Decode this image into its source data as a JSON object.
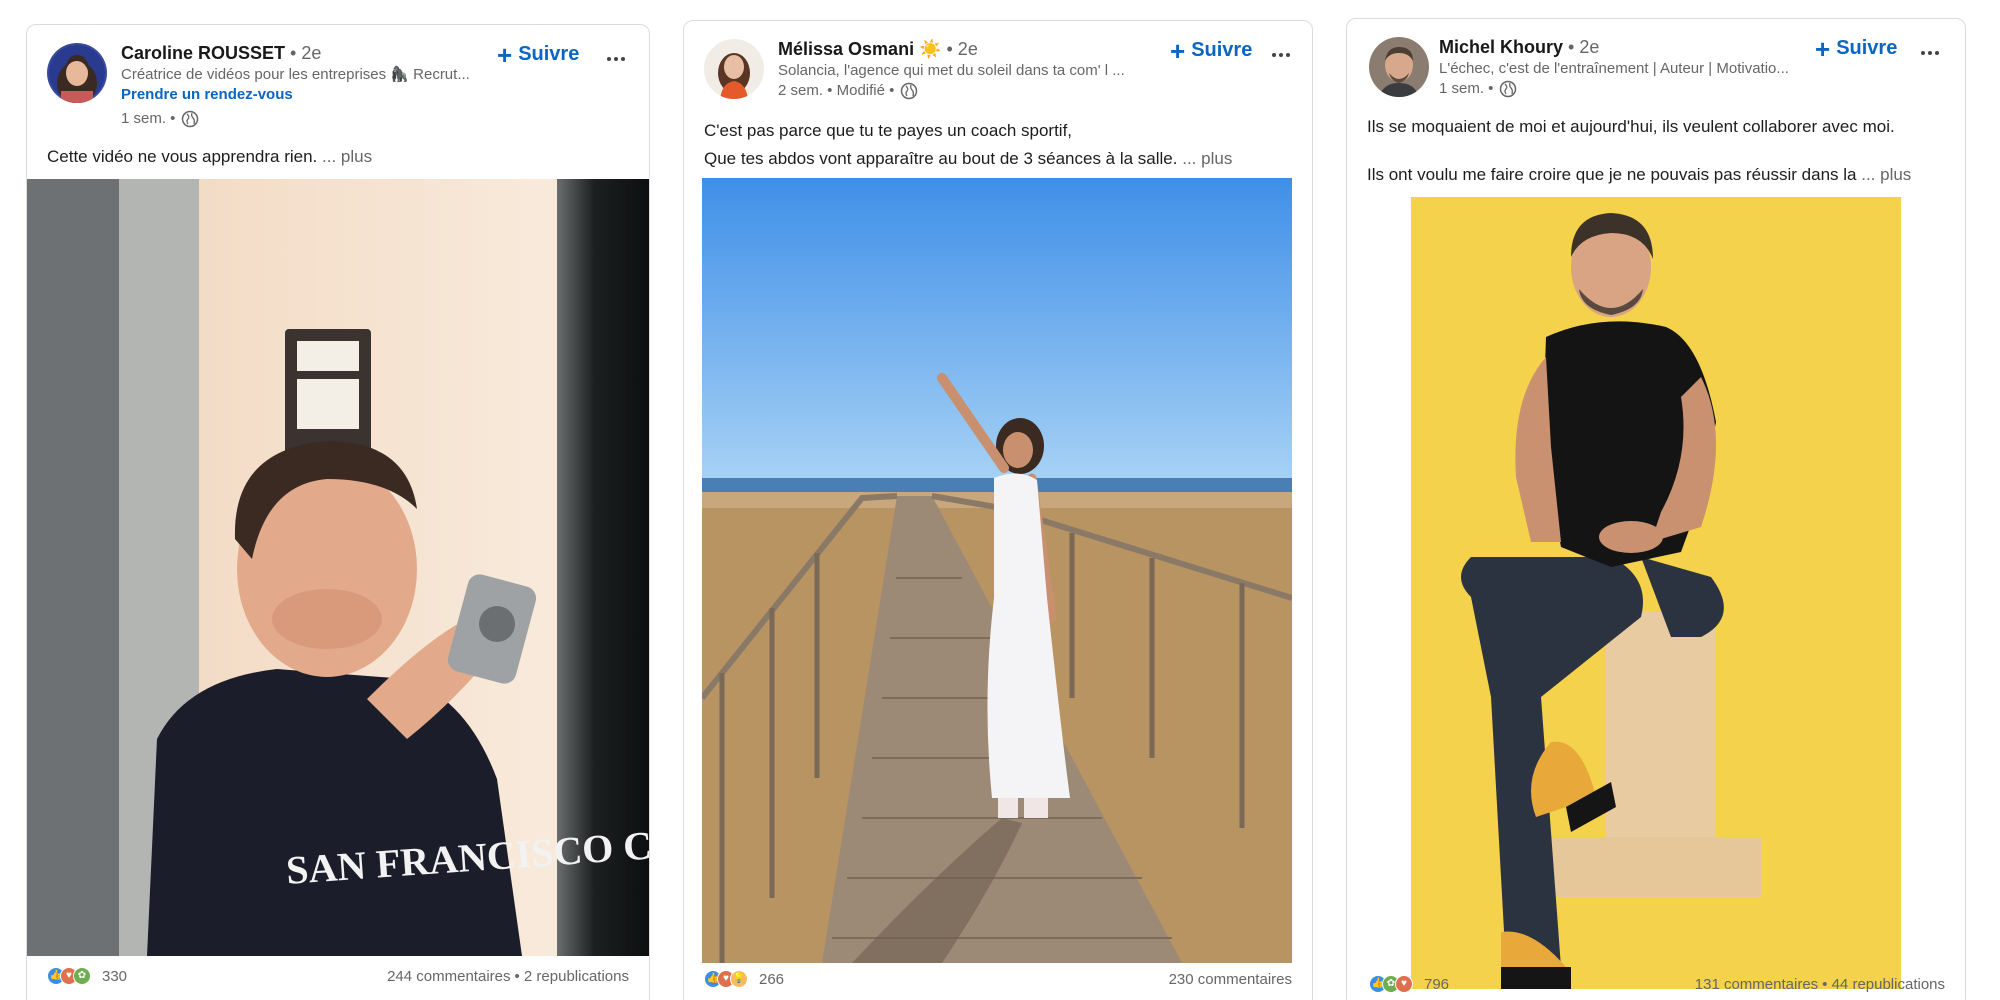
{
  "posts": [
    {
      "author": {
        "name": "Caroline ROUSSET",
        "degree": "• 2e",
        "headline": "Créatrice de vidéos pour les entreprises 🦍 Recrut...",
        "cta": "Prendre un rendez-vous",
        "time": "1 sem. •"
      },
      "follow_label": "Suivre",
      "text": "Cette vidéo ne vous apprendra rien.",
      "see_more": "... plus",
      "reaction_count": "330",
      "comments": "244 commentaires",
      "reposts": "• 2 republications",
      "media_caption": "SAN FRANCISCO CALIFORNIA",
      "reaction_icons": [
        "like-icon",
        "love-icon",
        "support-icon"
      ]
    },
    {
      "author": {
        "name": "Mélissa Osmani ☀️",
        "degree": "• 2e",
        "headline": "Solancia, l'agence qui met du soleil dans ta com' l ...",
        "time": "2 sem. • Modifié •"
      },
      "follow_label": "Suivre",
      "text_line1": "C'est pas parce que tu te payes un coach sportif,",
      "text_line2": "Que tes abdos vont apparaître au bout de 3 séances à la salle.",
      "see_more": "... plus",
      "reaction_count": "266",
      "comments": "230 commentaires",
      "reaction_icons": [
        "like-icon",
        "love-icon",
        "insightful-icon"
      ]
    },
    {
      "author": {
        "name": "Michel Khoury",
        "degree": "• 2e",
        "headline": "L'échec, c'est de l'entraînement | Auteur | Motivatio...",
        "time": "1 sem. •"
      },
      "follow_label": "Suivre",
      "text_line1": "Ils se moquaient de moi et aujourd'hui, ils veulent collaborer avec moi.",
      "text_line2": "Ils ont voulu me faire croire que je ne pouvais pas réussir dans la",
      "see_more": "... plus",
      "reaction_count": "796",
      "comments": "131 commentaires",
      "reposts": "• 44 republications",
      "reaction_icons": [
        "like-icon",
        "support-icon",
        "love-icon"
      ]
    }
  ],
  "colors": {
    "accent": "#0a66c2",
    "muted_text": "#666666",
    "like": "#378fe9",
    "love": "#df704d",
    "support": "#6dae4f",
    "insightful": "#f5bb5c",
    "yellow_backdrop": "#f5d24b"
  }
}
